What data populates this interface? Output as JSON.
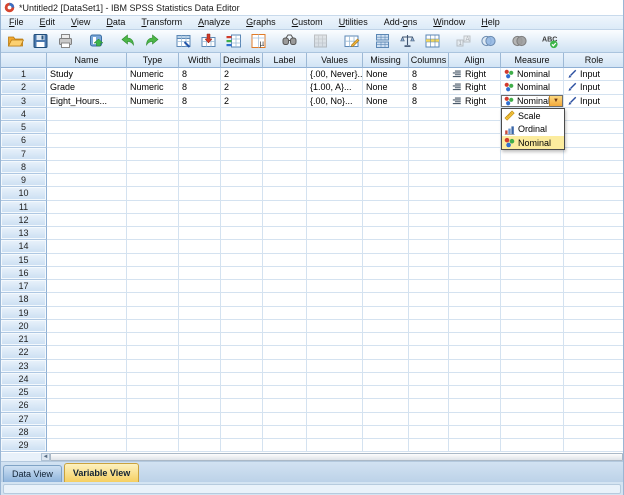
{
  "window": {
    "title": "*Untitled2 [DataSet1] - IBM SPSS Statistics Data Editor"
  },
  "menu": {
    "items": [
      {
        "label": "File",
        "u": 0
      },
      {
        "label": "Edit",
        "u": 0
      },
      {
        "label": "View",
        "u": 0
      },
      {
        "label": "Data",
        "u": 0
      },
      {
        "label": "Transform",
        "u": 0
      },
      {
        "label": "Analyze",
        "u": 0
      },
      {
        "label": "Graphs",
        "u": 0
      },
      {
        "label": "Custom",
        "u": 0
      },
      {
        "label": "Utilities",
        "u": 0
      },
      {
        "label": "Add-ons",
        "u": 4
      },
      {
        "label": "Window",
        "u": 0
      },
      {
        "label": "Help",
        "u": 0
      }
    ]
  },
  "toolbar": {
    "buttons": [
      {
        "name": "open-data-button",
        "icon": "open-icon",
        "disabled": false,
        "gap": false
      },
      {
        "name": "save-button",
        "icon": "save-icon",
        "disabled": false,
        "gap": false
      },
      {
        "name": "print-button",
        "icon": "print-icon",
        "disabled": false,
        "gap": false
      },
      {
        "name": "recall-dialogs-button",
        "icon": "recall-dialogs-icon",
        "disabled": false,
        "gap": true
      },
      {
        "name": "undo-button",
        "icon": "undo-icon",
        "disabled": false,
        "gap": true
      },
      {
        "name": "redo-button",
        "icon": "redo-icon",
        "disabled": false,
        "gap": false
      },
      {
        "name": "goto-case-button",
        "icon": "goto-case-icon",
        "disabled": false,
        "gap": true
      },
      {
        "name": "goto-variable-button",
        "icon": "goto-variable-icon",
        "disabled": false,
        "gap": false
      },
      {
        "name": "variables-button",
        "icon": "variables-icon",
        "disabled": false,
        "gap": false
      },
      {
        "name": "variable-info-button",
        "icon": "variable-info-icon",
        "disabled": false,
        "gap": false
      },
      {
        "name": "find-button",
        "icon": "find-icon",
        "disabled": false,
        "gap": true
      },
      {
        "name": "insert-cases-button",
        "icon": "insert-cases-icon",
        "disabled": true,
        "gap": true
      },
      {
        "name": "insert-variable-button",
        "icon": "insert-variable-icon",
        "disabled": false,
        "gap": true
      },
      {
        "name": "split-file-button",
        "icon": "split-file-icon",
        "disabled": false,
        "gap": true
      },
      {
        "name": "weight-cases-button",
        "icon": "weight-cases-icon",
        "disabled": false,
        "gap": false
      },
      {
        "name": "select-cases-button",
        "icon": "select-cases-icon",
        "disabled": false,
        "gap": false
      },
      {
        "name": "value-labels-button",
        "icon": "value-labels-icon",
        "disabled": true,
        "gap": true
      },
      {
        "name": "use-variable-sets-button",
        "icon": "use-variable-sets-icon",
        "disabled": false,
        "gap": false
      },
      {
        "name": "show-all-variables-button",
        "icon": "show-all-variables-icon",
        "disabled": false,
        "gap": true
      },
      {
        "name": "spell-check-button",
        "icon": "spell-check-icon",
        "disabled": false,
        "gap": true
      }
    ]
  },
  "grid": {
    "columns": [
      "Name",
      "Type",
      "Width",
      "Decimals",
      "Label",
      "Values",
      "Missing",
      "Columns",
      "Align",
      "Measure",
      "Role"
    ],
    "total_rows_visible": 29,
    "rows": [
      {
        "num": "1",
        "name": "Study",
        "type": "Numeric",
        "width": "8",
        "decimals": "2",
        "label": "",
        "values": "{.00, Never}...",
        "missing": "None",
        "columns": "8",
        "align": "Right",
        "measure": "Nominal",
        "role": "Input",
        "combo_open": false
      },
      {
        "num": "2",
        "name": "Grade",
        "type": "Numeric",
        "width": "8",
        "decimals": "2",
        "label": "",
        "values": "{1.00, A}...",
        "missing": "None",
        "columns": "8",
        "align": "Right",
        "measure": "Nominal",
        "role": "Input",
        "combo_open": false
      },
      {
        "num": "3",
        "name": "Eight_Hours...",
        "type": "Numeric",
        "width": "8",
        "decimals": "2",
        "label": "",
        "values": "{.00, No}...",
        "missing": "None",
        "columns": "8",
        "align": "Right",
        "measure": "Nominal",
        "role": "Input",
        "combo_open": true
      }
    ]
  },
  "measure_dropdown": {
    "options": [
      {
        "label": "Scale",
        "icon": "scale-measure-icon",
        "selected": false
      },
      {
        "label": "Ordinal",
        "icon": "ordinal-measure-icon",
        "selected": false
      },
      {
        "label": "Nominal",
        "icon": "nominal-measure-icon",
        "selected": true
      }
    ]
  },
  "tabs": [
    {
      "label": "Data View",
      "active": false
    },
    {
      "label": "Variable View",
      "active": true
    }
  ],
  "status_bar": {
    "text": ""
  },
  "colors": {
    "active_tab": "#f5cf62",
    "inactive_tab": "#8fb4dc",
    "dropdown_highlight": "#fcec9e",
    "combo_button": "#f2a93b",
    "grid_line": "#d4e2f0",
    "header_fill": "#d2e4f5"
  }
}
